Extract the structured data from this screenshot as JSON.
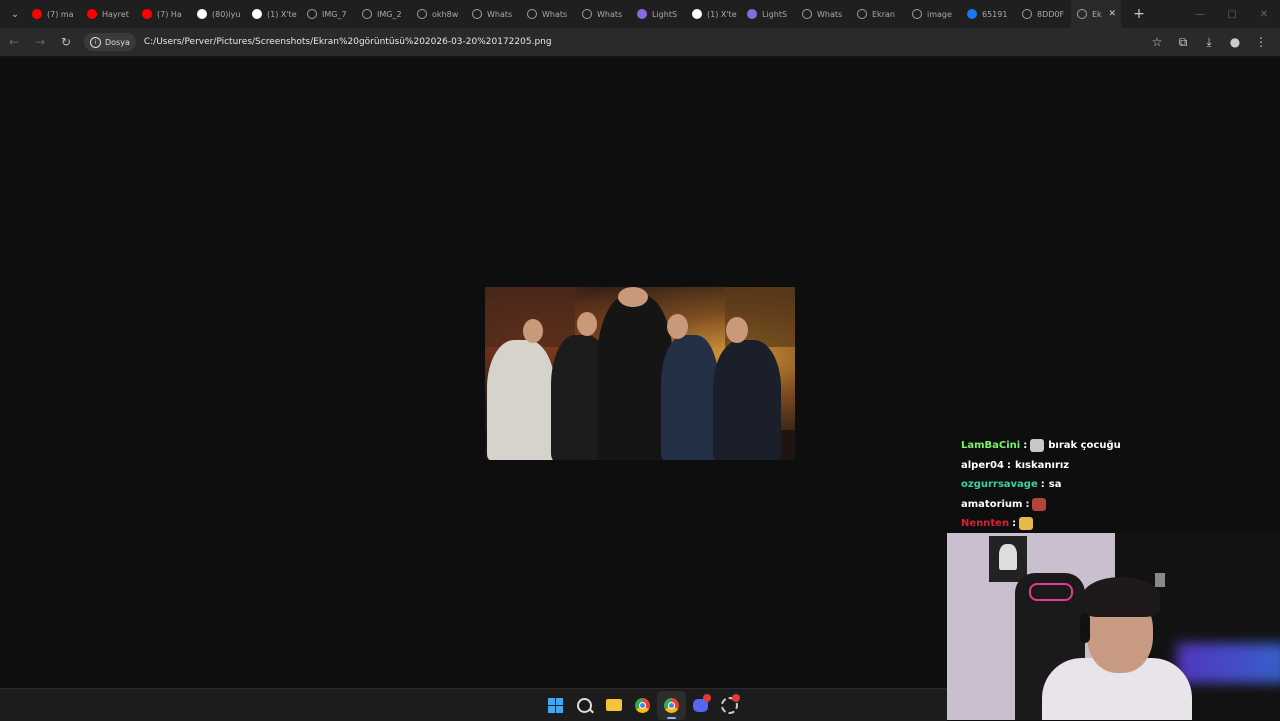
{
  "tabs": [
    {
      "label": "(7) ma",
      "favicon": "youtube-icon",
      "color": "#ff0000"
    },
    {
      "label": "Hayret",
      "favicon": "youtube-icon",
      "color": "#ff0000"
    },
    {
      "label": "(7) Ha",
      "favicon": "youtube-icon",
      "color": "#ff0000"
    },
    {
      "label": "(80)iyu",
      "favicon": "tiktok-icon",
      "color": "#ffffff"
    },
    {
      "label": "(1) X'te",
      "favicon": "x-icon",
      "color": "#ffffff"
    },
    {
      "label": "IMG_7",
      "favicon": "globe-icon",
      "color": "#9aa0a6"
    },
    {
      "label": "IMG_2",
      "favicon": "globe-icon",
      "color": "#9aa0a6"
    },
    {
      "label": "okh8w",
      "favicon": "globe-icon",
      "color": "#9aa0a6"
    },
    {
      "label": "Whats",
      "favicon": "globe-icon",
      "color": "#9aa0a6"
    },
    {
      "label": "Whats",
      "favicon": "globe-icon",
      "color": "#9aa0a6"
    },
    {
      "label": "Whats",
      "favicon": "globe-icon",
      "color": "#9aa0a6"
    },
    {
      "label": "LightS",
      "favicon": "feather-icon",
      "color": "#8a6ae0"
    },
    {
      "label": "(1) X'te",
      "favicon": "x-icon",
      "color": "#ffffff"
    },
    {
      "label": "LightS",
      "favicon": "feather-icon",
      "color": "#8a6ae0"
    },
    {
      "label": "Whats",
      "favicon": "globe-icon",
      "color": "#9aa0a6"
    },
    {
      "label": "Ekran",
      "favicon": "globe-icon",
      "color": "#9aa0a6"
    },
    {
      "label": "image",
      "favicon": "globe-icon",
      "color": "#9aa0a6"
    },
    {
      "label": "65191",
      "favicon": "facebook-icon",
      "color": "#1877f2"
    },
    {
      "label": "8DD0F",
      "favicon": "globe-icon",
      "color": "#9aa0a6"
    },
    {
      "label": "Ek",
      "favicon": "globe-icon",
      "color": "#9aa0a6",
      "active": true
    }
  ],
  "toolbar": {
    "chip_label": "Dosya",
    "url": "C:/Users/Perver/Pictures/Screenshots/Ekran%20görüntüsü%202026-03-20%20172205.png"
  },
  "chat": [
    {
      "user": "LamBaCini",
      "color": "#7cf06a",
      "message": "bırak çocuğu",
      "emote": "skull-emote"
    },
    {
      "user": "alper04",
      "color": "#ffffff",
      "message": "kıskanırız"
    },
    {
      "user": "ozgurrsavage",
      "color": "#3ad0a8",
      "message": "sa"
    },
    {
      "user": "amatorium",
      "color": "#ffffff",
      "message": "",
      "emote": "meme-emote"
    },
    {
      "user": "Nennten",
      "color": "#d81f3a",
      "message": "",
      "emote": "sa-emote"
    }
  ],
  "colors": {
    "accent": "#8ab4f8",
    "background": "#0e0e0e"
  }
}
